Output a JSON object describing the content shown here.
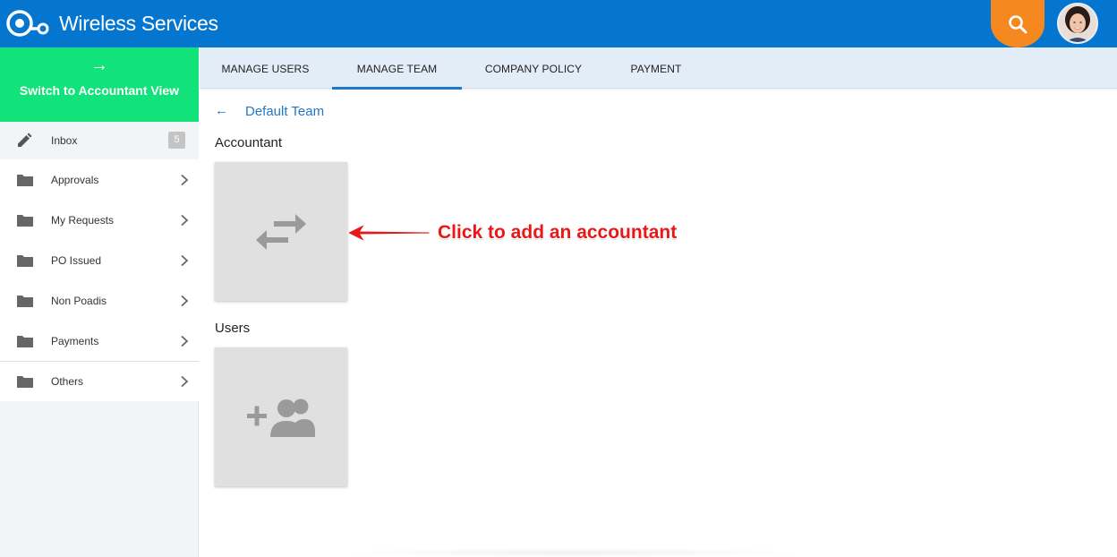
{
  "app": {
    "title": "Wireless Services",
    "brand_color": "#0576cf",
    "logo_icon": "logo-rings-icon"
  },
  "header": {
    "search_icon": "search-icon",
    "search_color": "#f5891f"
  },
  "sidebar": {
    "switch_view": {
      "arrow": "→",
      "label": "Switch to Accountant View",
      "color": "#12e27a"
    },
    "items": [
      {
        "label": "Inbox",
        "icon": "pencil-icon",
        "badge": "5"
      },
      {
        "label": "Approvals",
        "icon": "folder-icon"
      },
      {
        "label": "My Requests",
        "icon": "folder-icon"
      },
      {
        "label": "PO Issued",
        "icon": "folder-icon"
      },
      {
        "label": "Non Poadis",
        "icon": "folder-icon"
      },
      {
        "label": "Payments",
        "icon": "folder-icon"
      },
      {
        "label": "Others",
        "icon": "folder-icon"
      }
    ]
  },
  "tabs": [
    {
      "label": "MANAGE USERS",
      "active": false
    },
    {
      "label": "MANAGE TEAM",
      "active": true
    },
    {
      "label": "COMPANY POLICY",
      "active": false
    },
    {
      "label": "PAYMENT",
      "active": false
    }
  ],
  "content": {
    "back_arrow": "←",
    "team_name": "Default Team",
    "accountant_label": "Accountant",
    "accountant_card_icon": "swap-arrows-icon",
    "users_label": "Users",
    "users_card_icon": "add-group-icon"
  },
  "annotation": {
    "text": "Click to add an accountant",
    "color": "#e81818"
  }
}
